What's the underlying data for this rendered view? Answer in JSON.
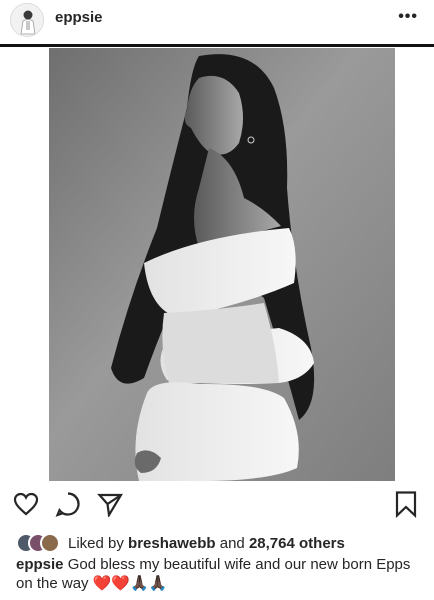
{
  "post": {
    "username": "eppsie",
    "more_label": "•••",
    "liked_by_prefix": "Liked by",
    "liked_by_user": "breshawebb",
    "liked_by_and": "and",
    "likes_others": "28,764 others",
    "caption_user": "eppsie",
    "caption_text": "God bless my beautiful wife and our  new born Epps on the way",
    "caption_emojis": "❤️❤️🙏🏿🙏🏿"
  },
  "icons": {
    "more": "more-options-icon",
    "like": "heart-icon",
    "comment": "comment-icon",
    "share": "paper-plane-icon",
    "save": "bookmark-icon"
  },
  "colors": {
    "text": "#262626",
    "heart": "#e53935",
    "photo_background": "#8a8a8a"
  }
}
